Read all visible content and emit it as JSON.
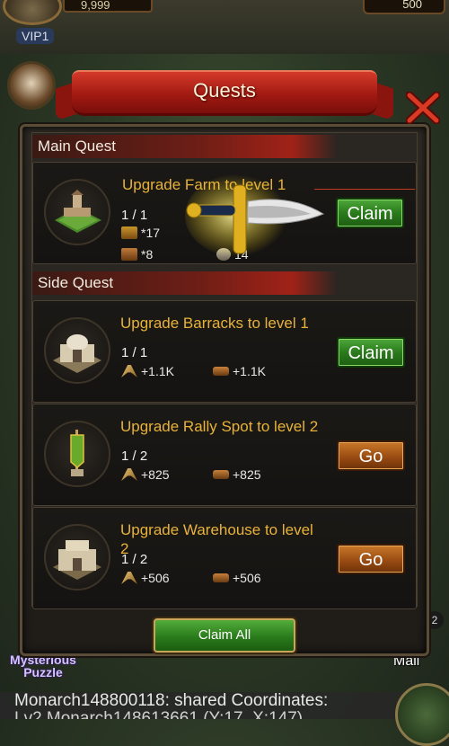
{
  "hud": {
    "vip_label": "VIP1",
    "resource_left": "9,999",
    "resource_right": "500",
    "mysterious_puzzle": "Mysterious Puzzle",
    "mail_label": "Mail",
    "badge": "2"
  },
  "dialog": {
    "title": "Quests",
    "main_section": "Main Quest",
    "side_section": "Side Quest",
    "claim_all_label": "Claim All"
  },
  "main_quest": {
    "title": "Upgrade Farm to level 1",
    "progress": "1 / 1",
    "reward1": "*17",
    "reward2": "*8",
    "reward3": "14",
    "button": "Claim"
  },
  "side_quests": [
    {
      "title": "Upgrade Barracks to level 1",
      "progress": "1 / 1",
      "food": "+1.1K",
      "wood": "+1.1K",
      "button": "Claim"
    },
    {
      "title": "Upgrade Rally Spot to level 2",
      "progress": "1 / 2",
      "food": "+825",
      "wood": "+825",
      "button": "Go"
    },
    {
      "title": "Upgrade Warehouse to level 2",
      "progress": "1 / 2",
      "food": "+506",
      "wood": "+506",
      "button": "Go"
    }
  ],
  "chat": {
    "line1": "Monarch148800118: shared Coordinates:",
    "line2": "Lv2 Monarch148613661 (Y:17, X:147)"
  }
}
